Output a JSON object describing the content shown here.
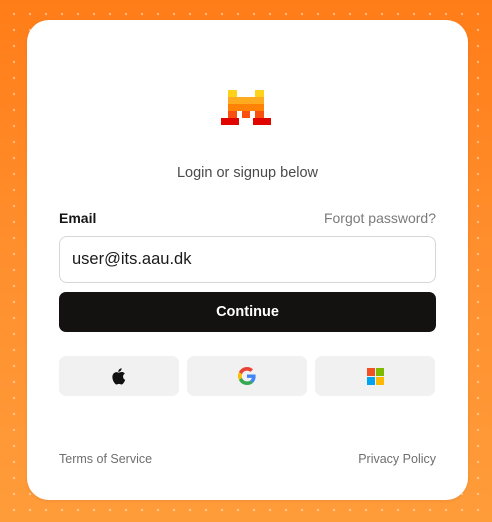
{
  "logo": {
    "icon": "mistral-logo-icon",
    "colors": [
      "#ffd21a",
      "#ffab1f",
      "#ff8205",
      "#fa500f",
      "#e10500"
    ]
  },
  "auth": {
    "subtitle": "Login or signup below",
    "email_label": "Email",
    "forgot_password": "Forgot password?",
    "email_value": "user@its.aau.dk",
    "continue_label": "Continue"
  },
  "social": [
    {
      "icon": "apple-icon"
    },
    {
      "icon": "google-icon"
    },
    {
      "icon": "microsoft-icon"
    }
  ],
  "footer": {
    "terms": "Terms of Service",
    "privacy": "Privacy Policy"
  },
  "colors": {
    "background": "#ff8a2a",
    "button": "#141210",
    "social_button": "#f1f1f1"
  }
}
